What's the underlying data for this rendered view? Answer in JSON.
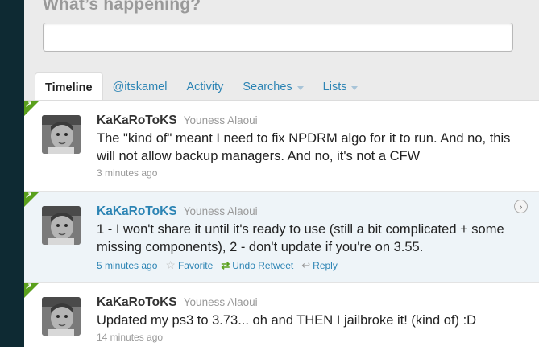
{
  "compose": {
    "heading": "What’s happening?",
    "value": ""
  },
  "tabs": [
    {
      "label": "Timeline",
      "active": true
    },
    {
      "label": "@itskamel"
    },
    {
      "label": "Activity"
    },
    {
      "label": "Searches",
      "dropdown": true
    },
    {
      "label": "Lists",
      "dropdown": true
    }
  ],
  "tweets": [
    {
      "screen_name": "KaKaRoToKS",
      "full_name": "Youness Alaoui",
      "text": "The \"kind of\" meant I need to fix NPDRM algo for it to run. And no, this will not allow backup managers. And no, it's not a CFW",
      "time": "3 minutes ago"
    },
    {
      "screen_name": "KaKaRoToKS",
      "full_name": "Youness Alaoui",
      "text": "1 - I won't share it until it's ready to use (still a bit complicated + some missing components), 2 - don't update if you're on 3.55.",
      "time": "5 minutes ago",
      "actions": {
        "favorite": "Favorite",
        "undo_retweet": "Undo Retweet",
        "reply": "Reply"
      },
      "expand_icon": "chevron-right-icon"
    },
    {
      "screen_name": "KaKaRoToKS",
      "full_name": "Youness Alaoui",
      "text": "Updated my ps3 to 3.73... oh and THEN I jailbroke it! (kind of) :D",
      "time": "14 minutes ago"
    }
  ],
  "colors": {
    "link": "#2c84b4",
    "retweet_green": "#5aa01c",
    "hover_row": "#eef4f8",
    "sidebar": "#0e2a33"
  }
}
